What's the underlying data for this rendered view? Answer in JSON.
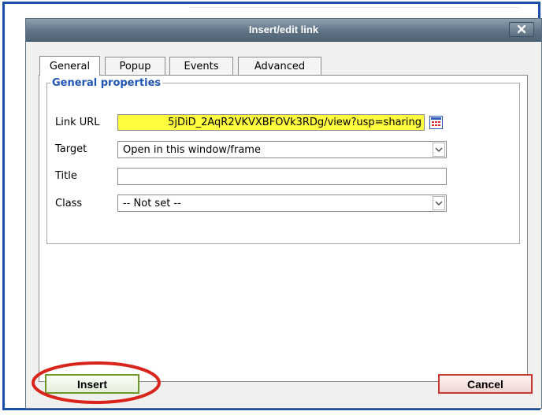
{
  "dialog": {
    "title": "Insert/edit link",
    "close_icon": "close-x-icon"
  },
  "tabs": [
    {
      "label": "General",
      "active": true
    },
    {
      "label": "Popup",
      "active": false
    },
    {
      "label": "Events",
      "active": false
    },
    {
      "label": "Advanced",
      "active": false
    }
  ],
  "general": {
    "legend": "General properties",
    "link_url_label": "Link URL",
    "link_url_value": "5jDiD_2AqR2VKVXBFOVk3RDg/view?usp=sharing",
    "browse_icon": "browse-links-icon",
    "target_label": "Target",
    "target_value": "Open in this window/frame",
    "title_label": "Title",
    "title_value": "",
    "class_label": "Class",
    "class_value": "-- Not set --"
  },
  "buttons": {
    "insert": "Insert",
    "cancel": "Cancel"
  },
  "colors": {
    "url_highlight": "#fffc3f",
    "legend_text": "#1f56b7",
    "annotation_circle": "#d9241c",
    "frame_border": "#1c4fa8"
  }
}
